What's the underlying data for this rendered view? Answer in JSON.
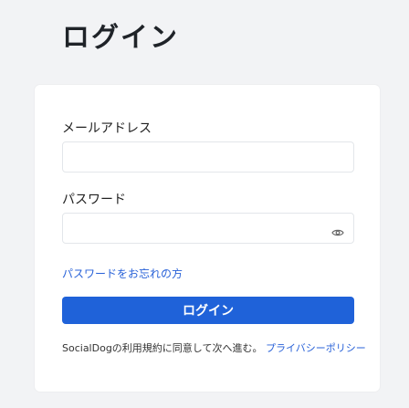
{
  "page": {
    "title": "ログイン"
  },
  "form": {
    "email_label": "メールアドレス",
    "email_value": "",
    "email_placeholder": "",
    "password_label": "パスワード",
    "password_value": "",
    "password_placeholder": "",
    "password_toggle_icon": "eye-icon",
    "forgot_password_text": "パスワードをお忘れの方",
    "login_button_label": "ログイン"
  },
  "footer": {
    "terms_prefix": "SocialDogの利用規約に同意して次へ進む。",
    "terms_link_text": "プライバシーポリシー"
  },
  "colors": {
    "background": "#f2f3f5",
    "card": "#ffffff",
    "primary": "#1f62d9",
    "link": "#2962d8"
  }
}
